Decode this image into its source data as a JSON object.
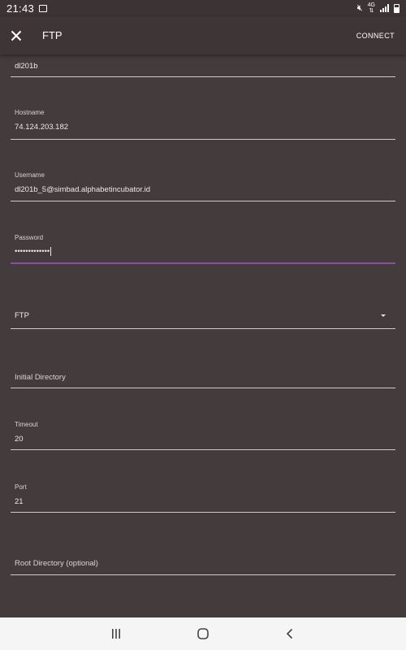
{
  "status_bar": {
    "time": "21:43",
    "network": "4G",
    "icons": [
      "image-icon",
      "mute-icon",
      "data-arrows-icon",
      "signal-icon",
      "battery-icon"
    ]
  },
  "toolbar": {
    "close_icon": "close-icon",
    "title": "FTP",
    "connect_label": "CONNECT"
  },
  "form": {
    "name": {
      "value": "dl201b"
    },
    "hostname": {
      "label": "Hostname",
      "value": "74.124.203.182"
    },
    "username": {
      "label": "Username",
      "value": "dl201b_5@simbad.alphabetincubator.id"
    },
    "password": {
      "label": "Password",
      "value": "•••••••••••••"
    },
    "protocol": {
      "value": "FTP"
    },
    "initial_directory": {
      "placeholder": "Initial Directory"
    },
    "timeout": {
      "label": "Timeout",
      "value": "20"
    },
    "port": {
      "label": "Port",
      "value": "21"
    },
    "root_directory": {
      "placeholder": "Root Directory (optional)"
    }
  },
  "colors": {
    "background": "#443b3c",
    "toolbar": "#3d3536",
    "focus_underline": "#8a4ea8",
    "navbar": "#f5f5f5"
  },
  "navbar": {
    "icons": [
      "recent-apps-icon",
      "home-icon",
      "back-icon"
    ]
  }
}
